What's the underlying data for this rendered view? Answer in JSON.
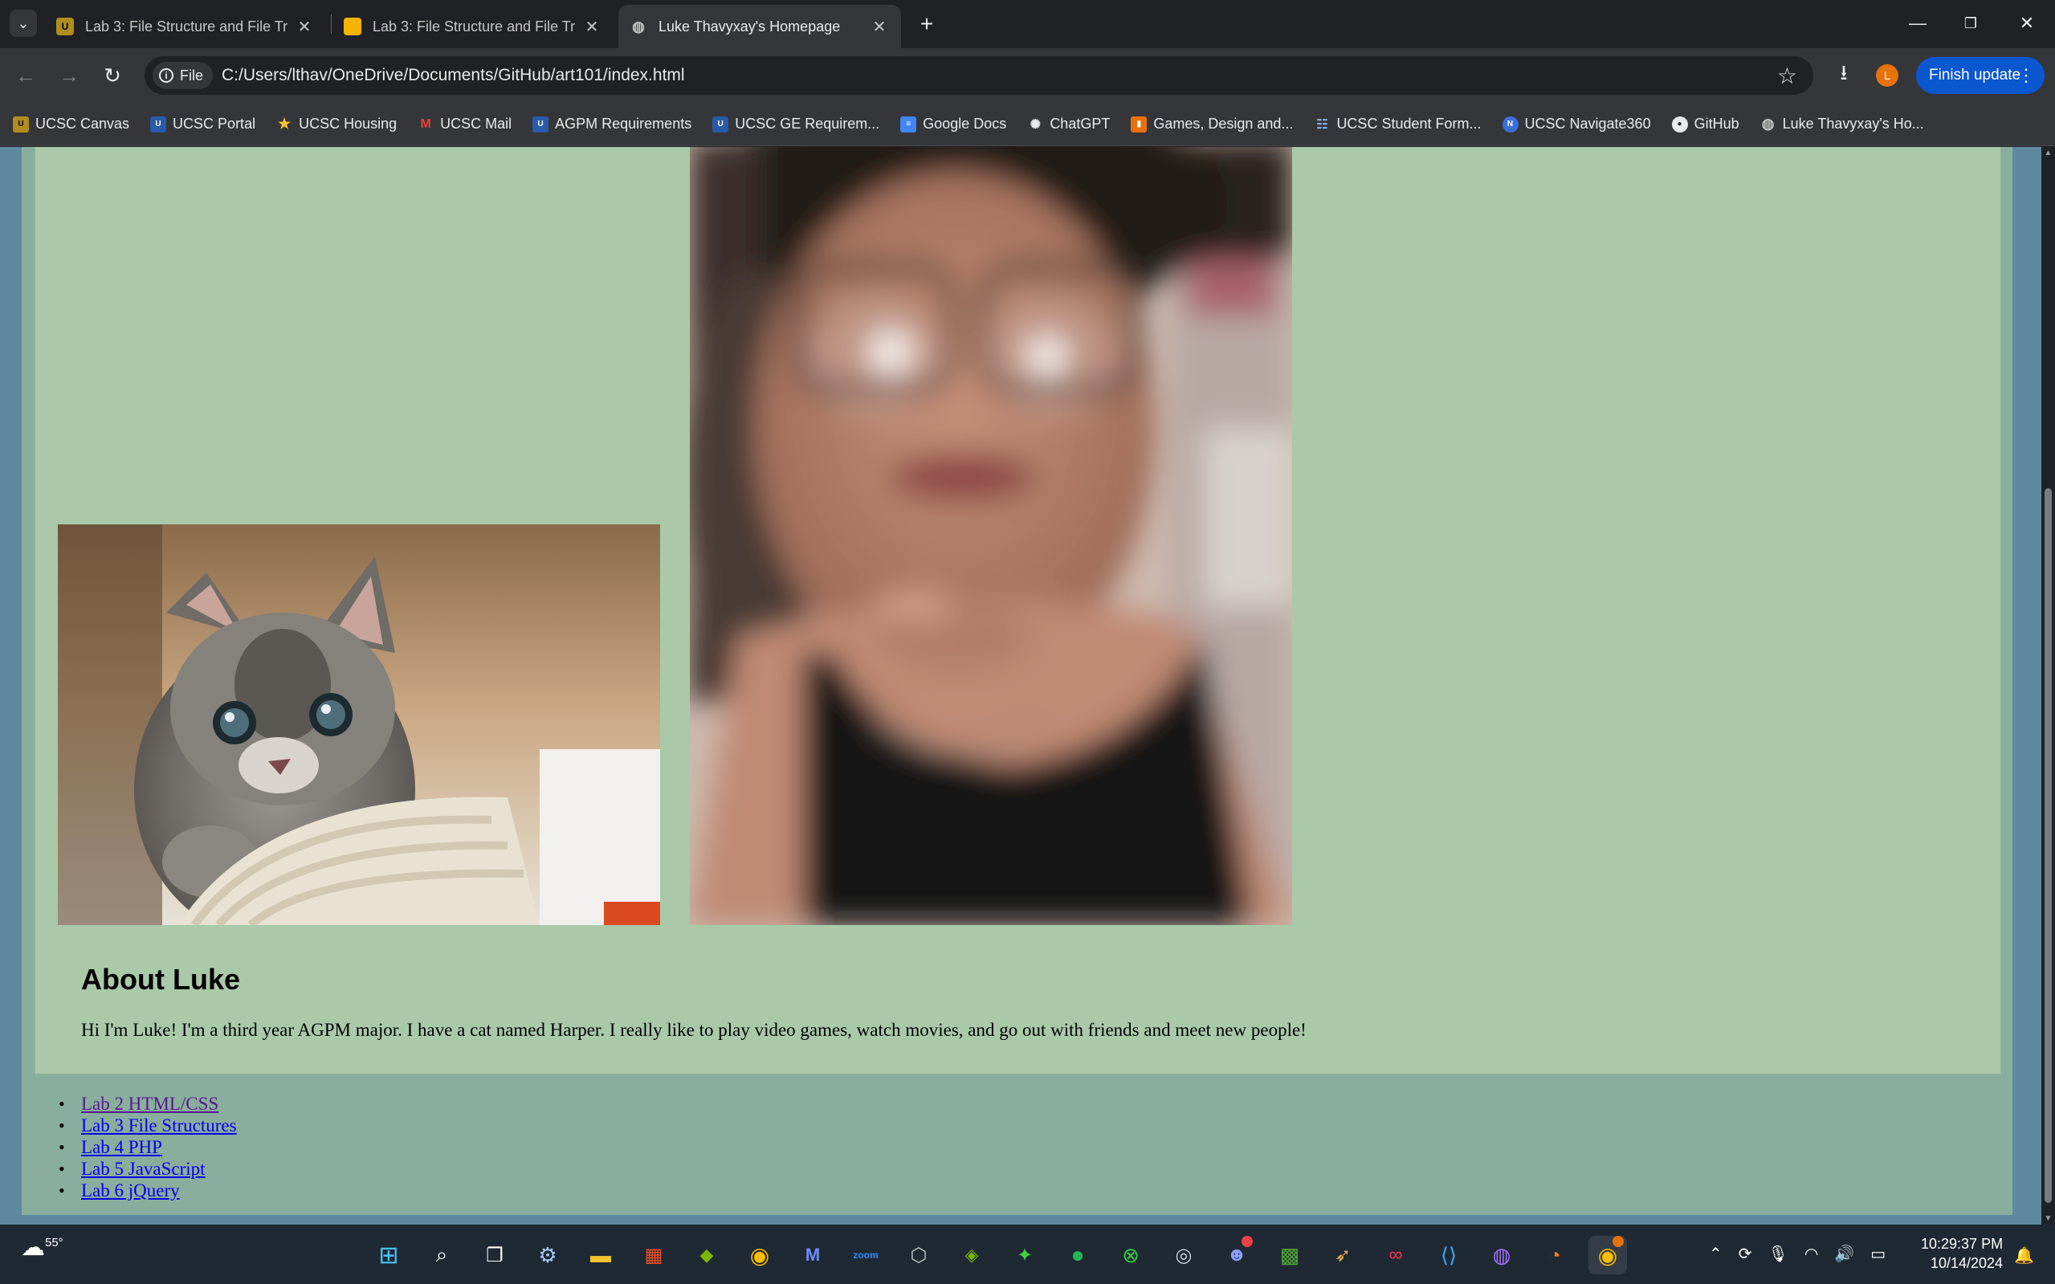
{
  "tabs": [
    {
      "title": "Lab 3: File Structure and File Tra",
      "favicon": "canvas-icon",
      "active": false
    },
    {
      "title": "Lab 3: File Structure and File Tra",
      "favicon": "slides-icon",
      "active": false
    },
    {
      "title": "Luke Thavyxay's Homepage",
      "favicon": "globe-icon",
      "active": true
    }
  ],
  "toolbar": {
    "chip_label": "File",
    "url": "C:/Users/lthav/OneDrive/Documents/GitHub/art101/index.html",
    "profile_initial": "L",
    "finish_update_label": "Finish update"
  },
  "bookmarks": [
    {
      "label": "UCSC Canvas",
      "icon": "ucsc-icon"
    },
    {
      "label": "UCSC Portal",
      "icon": "ucsc-icon"
    },
    {
      "label": "UCSC Housing",
      "icon": "star-icon"
    },
    {
      "label": "UCSC Mail",
      "icon": "gmail-icon"
    },
    {
      "label": "AGPM Requirements",
      "icon": "ucsc-icon"
    },
    {
      "label": "UCSC GE Requirem...",
      "icon": "ucsc-icon"
    },
    {
      "label": "Google Docs",
      "icon": "docs-icon"
    },
    {
      "label": "ChatGPT",
      "icon": "chatgpt-icon"
    },
    {
      "label": "Games, Design and...",
      "icon": "bookmark-icon"
    },
    {
      "label": "UCSC Student Form...",
      "icon": "form-icon"
    },
    {
      "label": "UCSC Navigate360",
      "icon": "navigate-icon"
    },
    {
      "label": "GitHub",
      "icon": "github-icon"
    },
    {
      "label": "Luke Thavyxay's Ho...",
      "icon": "globe-icon"
    }
  ],
  "page": {
    "about_heading": "About Luke",
    "about_text": "Hi I'm Luke! I'm a third year AGPM major. I have a cat named Harper. I really like to play video games, watch movies, and go out with friends and meet new people!",
    "links": [
      {
        "label": "Lab 2 HTML/CSS",
        "visited": true
      },
      {
        "label": "Lab 3 File Structures",
        "visited": false
      },
      {
        "label": "Lab 4 PHP",
        "visited": false
      },
      {
        "label": "Lab 5 JavaScript",
        "visited": false
      },
      {
        "label": "Lab 6 jQuery",
        "visited": false
      }
    ]
  },
  "taskbar": {
    "weather_temp": "55°",
    "time": "10:29:37 PM",
    "date": "10/14/2024"
  },
  "colors": {
    "page_bg": "#5e8aa0",
    "outer_bg": "#8aae9d",
    "card_bg": "#a9c9a9"
  }
}
